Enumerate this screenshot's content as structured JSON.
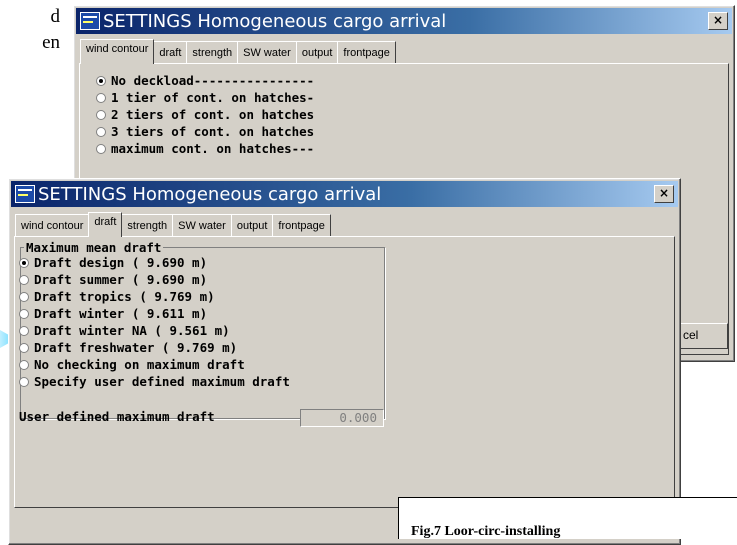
{
  "page_text": {
    "line1": "d",
    "line2": "en"
  },
  "back_window": {
    "title": "SETTINGS Homogeneous cargo arrival",
    "close_label": "×",
    "tabs": [
      "wind contour",
      "draft",
      "strength",
      "SW water",
      "output",
      "frontpage"
    ],
    "active_tab": 0,
    "options": [
      {
        "label": "No deckload----------------",
        "selected": true
      },
      {
        "label": "1 tier of cont. on hatches-",
        "selected": false
      },
      {
        "label": "2 tiers of cont. on hatches",
        "selected": false
      },
      {
        "label": "3 tiers of cont. on hatches",
        "selected": false
      },
      {
        "label": "maximum cont. on hatches---",
        "selected": false
      }
    ],
    "button_label": "cel"
  },
  "front_window": {
    "title": "SETTINGS Homogeneous cargo arrival",
    "close_label": "×",
    "tabs": [
      "wind contour",
      "draft",
      "strength",
      "SW water",
      "output",
      "frontpage"
    ],
    "active_tab": 1,
    "group_title": "Maximum mean draft",
    "options": [
      {
        "label": "Draft design ( 9.690 m)",
        "selected": true
      },
      {
        "label": "Draft summer ( 9.690 m)",
        "selected": false
      },
      {
        "label": "Draft tropics ( 9.769 m)",
        "selected": false
      },
      {
        "label": "Draft winter ( 9.611 m)",
        "selected": false
      },
      {
        "label": "Draft winter NA ( 9.561 m)",
        "selected": false
      },
      {
        "label": "Draft freshwater ( 9.769 m)",
        "selected": false
      },
      {
        "label": "No checking on maximum draft",
        "selected": false
      },
      {
        "label": "Specify user defined maximum draft",
        "selected": false
      }
    ],
    "user_defined_label": "User defined maximum draft",
    "user_defined_value": "0.000"
  },
  "caption": {
    "text": "Fig.7 Loor-circ-installing"
  },
  "colors": {
    "title_start": "#0a246a",
    "title_end": "#a6caf0",
    "face": "#d4d0c8",
    "arrow": "#5fd7ff"
  }
}
